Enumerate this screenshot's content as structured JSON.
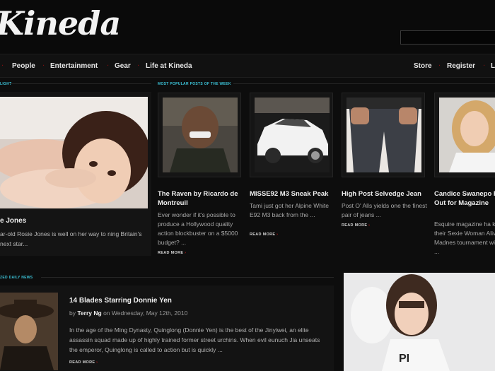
{
  "site": {
    "logo": "Kineda"
  },
  "nav": {
    "items": [
      "People",
      "Entertainment",
      "Gear",
      "Life at Kineda"
    ],
    "right": [
      "Store",
      "Register",
      "L"
    ]
  },
  "sections": {
    "spotlight": "LIGHT",
    "popular": "MOST POPULAR POSTS OF THE WEEK",
    "daily": "ZED DAILY NEWS"
  },
  "feature": {
    "title": "e Jones",
    "text": "ar-old Rosie Jones is well on her way to ning Britain's next star..."
  },
  "cards": [
    {
      "title": "The Raven by Ricardo de Montreuil",
      "text": "Ever wonder if it's possible to produce a Hollywood quality action blockbuster on a $5000 budget? ...",
      "more": "READ MORE"
    },
    {
      "title": "MISSE92 M3 Sneak Peak",
      "text": "Tami just got her Alpine White E92 M3 back from the ...",
      "more": "READ MORE"
    },
    {
      "title": "High Post Selvedge Jean",
      "text": "Post O' Alls yields one the finest pair of jeans ...",
      "more": "READ MORE"
    },
    {
      "title": "Candice Swanepo Rocks it Out for Magazine",
      "text": "Esquire magazine ha kicked off their Sexie Woman Alive Madnes tournament with so the ...",
      "more": ""
    }
  ],
  "daily": {
    "title": "14 Blades Starring Donnie Yen",
    "by": "by",
    "author": "Terry Ng",
    "date": "on Wednesday, May 12th, 2010",
    "text": "In the age of the Ming Dynasty, Quinglong (Donnie Yen) is the best of the Jinyiwei, an elite assassin squad made up of highly trained former street urchins. When evil eunuch Jia unseats the emperor, Quinglong is called to action but is quickly ...",
    "more": "READ MORE"
  },
  "ui": {
    "arrow": "›"
  },
  "colors": {
    "accent": "#3cc3d8",
    "nav_dot": "#8a1010",
    "read_more_arrow": "#c31a1a"
  }
}
